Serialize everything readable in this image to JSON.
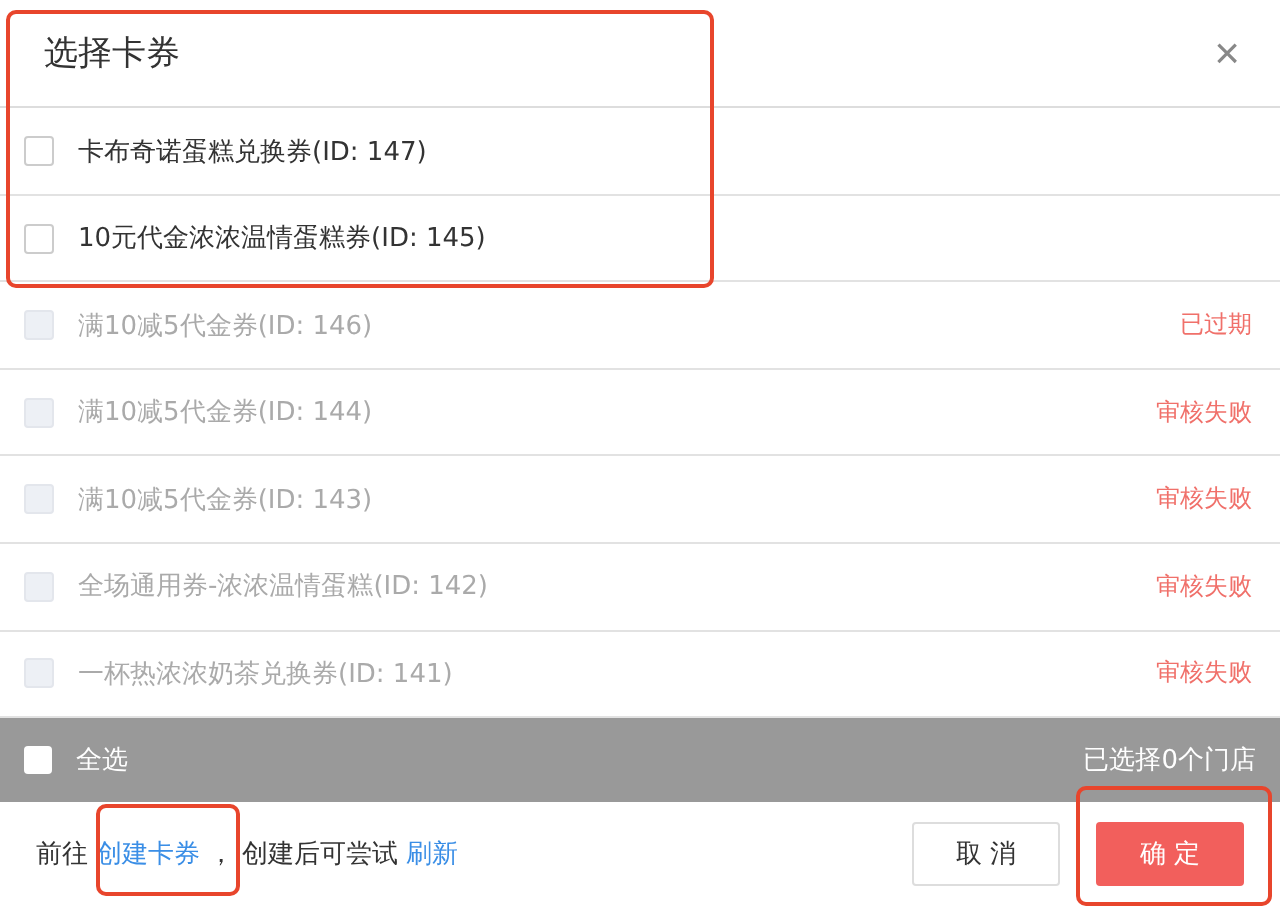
{
  "dialog": {
    "title": "选择卡券",
    "close": "×"
  },
  "coupons": [
    {
      "name": "卡布奇诺蛋糕兑换券(ID: 147)",
      "checked": false,
      "disabled": false
    },
    {
      "name": "10元代金浓浓温情蛋糕券(ID: 145)",
      "checked": false,
      "disabled": false
    },
    {
      "name": "满10减5代金券(ID: 146)",
      "checked": false,
      "disabled": true,
      "status": "已过期"
    },
    {
      "name": "满10减5代金券(ID: 144)",
      "checked": false,
      "disabled": true,
      "status": "审核失败"
    },
    {
      "name": "满10减5代金券(ID: 143)",
      "checked": false,
      "disabled": true,
      "status": "审核失败"
    },
    {
      "name": "全场通用券-浓浓温情蛋糕(ID: 142)",
      "checked": false,
      "disabled": true,
      "status": "审核失败"
    },
    {
      "name": "一杯热浓浓奶茶兑换券(ID: 141)",
      "checked": false,
      "disabled": true,
      "status": "审核失败"
    }
  ],
  "select_all": {
    "label": "全选",
    "checked": false,
    "summary": "已选择0个门店"
  },
  "footer": {
    "prefix": "前往",
    "create_link": "创建卡券",
    "comma": "，",
    "middle": "创建后可尝试",
    "refresh_link": "刷新"
  },
  "buttons": {
    "cancel": "取 消",
    "confirm": "确 定"
  }
}
